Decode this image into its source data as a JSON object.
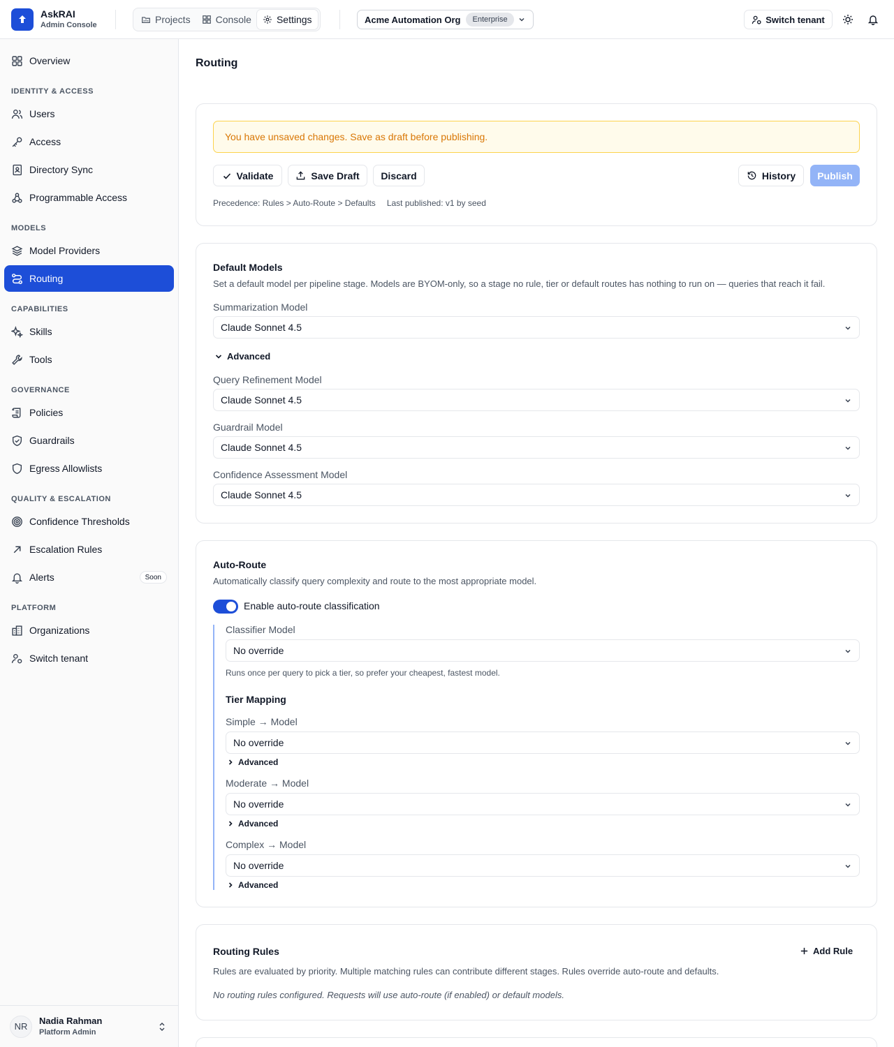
{
  "brand": {
    "name": "AskRAI",
    "subtitle": "Admin Console"
  },
  "nav_tabs": [
    {
      "label": "Projects",
      "icon": "folder-icon"
    },
    {
      "label": "Console",
      "icon": "grid-icon"
    },
    {
      "label": "Settings",
      "icon": "gear-icon",
      "active": true
    }
  ],
  "org": {
    "name": "Acme Automation Org",
    "plan": "Enterprise"
  },
  "header": {
    "switch_tenant": "Switch tenant"
  },
  "sidebar": {
    "overview": "Overview",
    "groups": {
      "identity": "IDENTITY & ACCESS",
      "models": "MODELS",
      "capabilities": "CAPABILITIES",
      "governance": "GOVERNANCE",
      "quality": "QUALITY & ESCALATION",
      "platform": "PLATFORM"
    },
    "items": {
      "users": "Users",
      "access": "Access",
      "directory_sync": "Directory Sync",
      "programmable_access": "Programmable Access",
      "model_providers": "Model Providers",
      "routing": "Routing",
      "skills": "Skills",
      "tools": "Tools",
      "policies": "Policies",
      "guardrails": "Guardrails",
      "egress": "Egress Allowlists",
      "confidence": "Confidence Thresholds",
      "escalation": "Escalation Rules",
      "alerts": "Alerts",
      "organizations": "Organizations",
      "switch_tenant": "Switch tenant"
    },
    "alerts_badge": "Soon",
    "user": {
      "initials": "NR",
      "name": "Nadia Rahman",
      "role": "Platform Admin"
    }
  },
  "page": {
    "title": "Routing"
  },
  "draft": {
    "warning": "You have unsaved changes. Save as draft before publishing.",
    "validate": "Validate",
    "save_draft": "Save Draft",
    "discard": "Discard",
    "history": "History",
    "publish": "Publish",
    "precedence": "Precedence: Rules > Auto-Route > Defaults",
    "last_published": "Last published: v1 by seed"
  },
  "defaults": {
    "title": "Default Models",
    "desc": "Set a default model per pipeline stage. Models are BYOM-only, so a stage no rule, tier or default routes has nothing to run on — queries that reach it fail.",
    "summarization_label": "Summarization Model",
    "summarization_value": "Claude Sonnet 4.5",
    "advanced": "Advanced",
    "query_refinement_label": "Query Refinement Model",
    "query_refinement_value": "Claude Sonnet 4.5",
    "guardrail_label": "Guardrail Model",
    "guardrail_value": "Claude Sonnet 4.5",
    "confidence_label": "Confidence Assessment Model",
    "confidence_value": "Claude Sonnet 4.5"
  },
  "autoroute": {
    "title": "Auto-Route",
    "desc": "Automatically classify query complexity and route to the most appropriate model.",
    "toggle_label": "Enable auto-route classification",
    "enabled": true,
    "classifier_label": "Classifier Model",
    "classifier_value": "No override",
    "classifier_hint": "Runs once per query to pick a tier, so prefer your cheapest, fastest model.",
    "tier_mapping": "Tier Mapping",
    "simple_label": "Simple → Model",
    "simple_value": "No override",
    "moderate_label": "Moderate → Model",
    "moderate_value": "No override",
    "complex_label": "Complex → Model",
    "complex_value": "No override",
    "advanced": "Advanced"
  },
  "rules": {
    "title": "Routing Rules",
    "add": "Add Rule",
    "desc": "Rules are evaluated by priority. Multiple matching rules can contribute different stages. Rules override auto-route and defaults.",
    "empty": "No routing rules configured. Requests will use auto-route (if enabled) or default models."
  },
  "colors": {
    "accent": "#1d4ed8",
    "warning_text": "#d97706",
    "warning_bg": "#fffbeb",
    "publish_disabled": "#93b4f7"
  }
}
